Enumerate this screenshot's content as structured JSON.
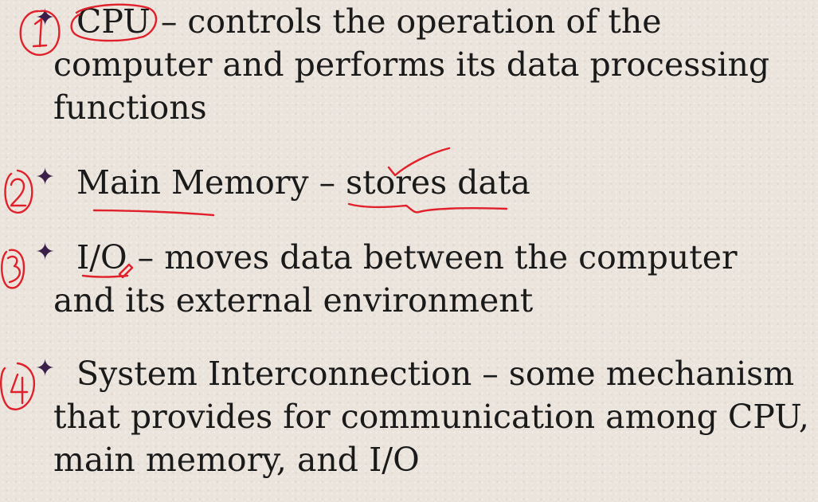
{
  "bullets": [
    {
      "number": "1",
      "lines": [
        "CPU – controls the operation of the",
        "computer and performs its data processing",
        "functions"
      ]
    },
    {
      "number": "2",
      "lines": [
        "Main Memory – stores data"
      ]
    },
    {
      "number": "3",
      "lines": [
        "I/O – moves data between the computer",
        "and its external environment"
      ]
    },
    {
      "number": "4",
      "lines": [
        "System Interconnection – some mechanism",
        "that provides for communication among CPU,",
        "main memory, and I/O"
      ]
    }
  ],
  "colors": {
    "background": "#ebe4dc",
    "text": "#1a1a1a",
    "bullet_star": "#3a1f4a",
    "annotation_ink": "#e0202a"
  },
  "icons": {
    "bullet": "four-point-star-icon"
  }
}
